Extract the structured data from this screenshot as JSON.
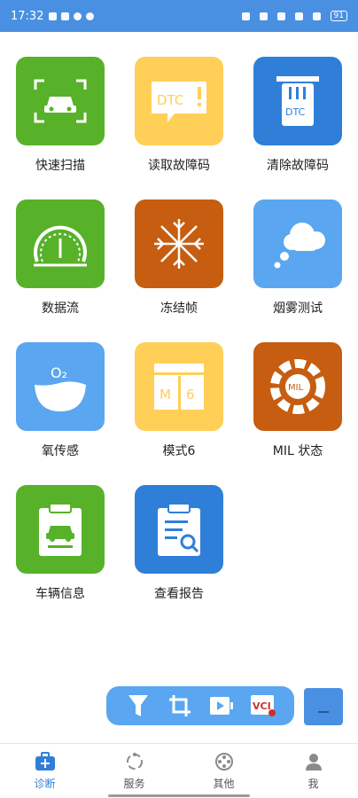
{
  "status_bar": {
    "time": "17:32",
    "battery": "91"
  },
  "grid": {
    "items": [
      {
        "label": "快速扫描",
        "icon": "car-scan-icon",
        "color": "#57b22a"
      },
      {
        "label": "读取故障码",
        "icon": "dtc-alert-icon",
        "color": "#ffcf57"
      },
      {
        "label": "清除故障码",
        "icon": "dtc-trash-icon",
        "color": "#2f7fd9"
      },
      {
        "label": "数据流",
        "icon": "gauge-icon",
        "color": "#57b22a"
      },
      {
        "label": "冻结帧",
        "icon": "snowflake-icon",
        "color": "#c65d10"
      },
      {
        "label": "烟雾测试",
        "icon": "smoke-cloud-icon",
        "color": "#5aa6f0"
      },
      {
        "label": "氧传感",
        "icon": "oxygen-sensor-icon",
        "color": "#5aa6f0"
      },
      {
        "label": "模式6",
        "icon": "mode6-icon",
        "color": "#ffcf57"
      },
      {
        "label": "MIL 状态",
        "icon": "mil-status-icon",
        "color": "#c65d10"
      },
      {
        "label": "车辆信息",
        "icon": "vehicle-clipboard-icon",
        "color": "#57b22a"
      },
      {
        "label": "查看报告",
        "icon": "report-search-icon",
        "color": "#2f7fd9"
      }
    ],
    "dtc_text": "DTC",
    "mode_letter": "M",
    "mode_number": "6",
    "mil_text": "MIL",
    "o2_text": "O₂"
  },
  "toolbar": {
    "tools": [
      "filter-icon",
      "crop-icon",
      "record-video-icon",
      "vci-icon"
    ],
    "vci_text": "VCI"
  },
  "tabbar": {
    "tabs": [
      {
        "label": "诊断",
        "icon": "medkit-icon",
        "active": true
      },
      {
        "label": "服务",
        "icon": "service-icon",
        "active": false
      },
      {
        "label": "其他",
        "icon": "film-reel-icon",
        "active": false
      },
      {
        "label": "我",
        "icon": "person-icon",
        "active": false
      }
    ]
  }
}
